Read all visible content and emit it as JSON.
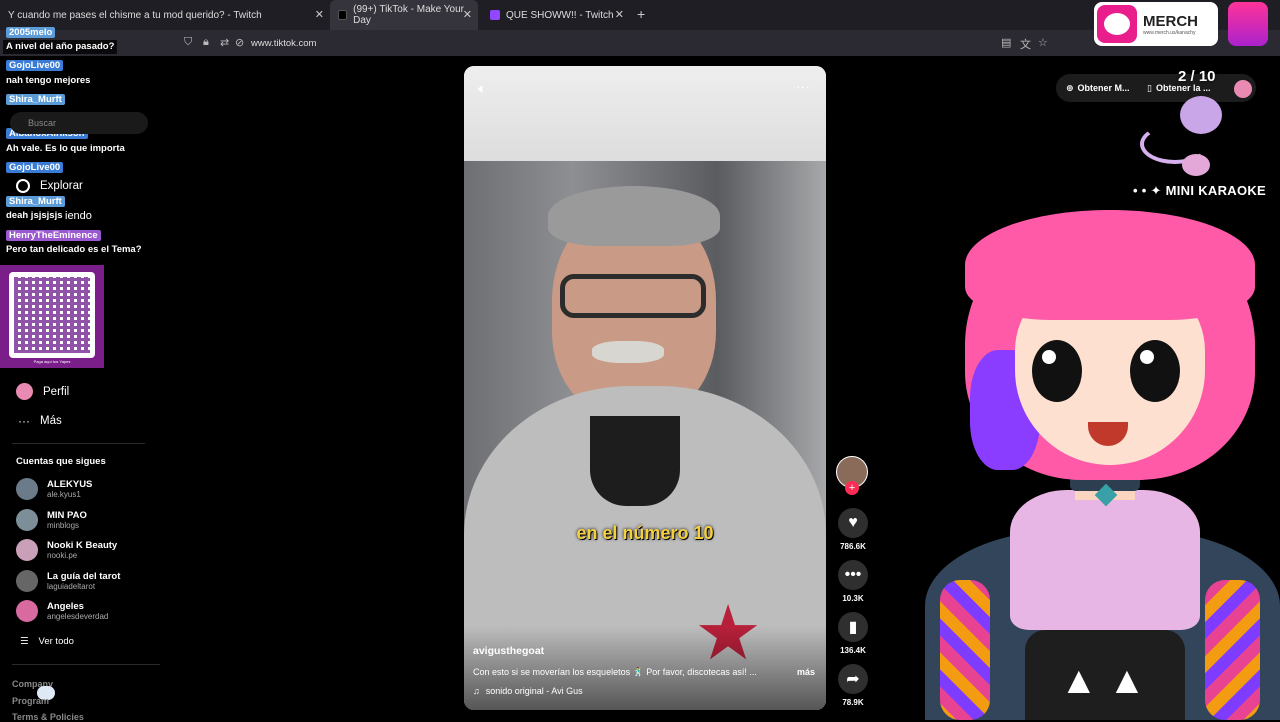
{
  "tabs": [
    {
      "title": "Y cuando me pases el chisme a tu mod querido? - Twitch"
    },
    {
      "title": "(99+) TikTok - Make Your Day"
    },
    {
      "title": "QUE SHOWW!! - Twitch"
    }
  ],
  "url": "www.tiktok.com",
  "chat": [
    {
      "user": "2005melo",
      "msg": "A nivel del año pasado?",
      "color": "#5a9bd8"
    },
    {
      "user": "GojoLive00",
      "msg": "nah tengo mejores",
      "color": "#3a7bd5"
    },
    {
      "user": "Shira_Murft",
      "msg": "",
      "color": "#5a9bd8"
    },
    {
      "user": "AlbanoxAirikson",
      "msg": "Ah vale. Es lo que importa",
      "color": "#3a7bd5"
    },
    {
      "user": "GojoLive00",
      "msg": "",
      "color": "#3a7bd5"
    },
    {
      "user": "Shira_Murft",
      "msg": "deah jsjsjsjs",
      "color": "#5a9bd8"
    },
    {
      "user": "HenryTheEminence",
      "msg": "Pero tan delicado es el Tema?",
      "color": "#9b59d0"
    }
  ],
  "search_placeholder": "Buscar",
  "sidebar": {
    "explore": "Explorar",
    "partial_text": "iendo",
    "profile": "Perfil",
    "more": "Más",
    "following_title": "Cuentas que sigues",
    "following": [
      {
        "name": "ALEKYUS",
        "handle": "ale.kyus1"
      },
      {
        "name": "MIN PAO",
        "handle": "minblogs"
      },
      {
        "name": "Nooki K Beauty",
        "handle": "nooki.pe"
      },
      {
        "name": "La guía del tarot",
        "handle": "laguiadeltarot"
      },
      {
        "name": "Angeles",
        "handle": "angelesdeverdad"
      }
    ],
    "see_all": "Ver todo",
    "company": "Company",
    "program": "Program",
    "terms": "Terms & Policies"
  },
  "video": {
    "caption_overlay": "en el número 10",
    "author": "avigusthegoat",
    "description": "Con esto si se moverían los esqueletos 🕺 Por favor, discotecas así! ...",
    "more": "más",
    "sound": "sonido original - Avi Gus"
  },
  "actions": {
    "likes": "786.6K",
    "comments": "10.3K",
    "saves": "136.4K",
    "shares": "78.9K"
  },
  "top_right": {
    "get_app_1": "Obtener M...",
    "get_app_2": "Obtener la ...",
    "counter": "2 / 10",
    "merch": "MERCH",
    "merch_url": "www.merch.us/kanachy",
    "mini_karaoke": "MINI KARAOKE"
  },
  "qr_caption": "Paga aquí tus Yapes",
  "colors": {
    "accent": "#fe2c55",
    "merch_pink": "#e91e8c"
  }
}
